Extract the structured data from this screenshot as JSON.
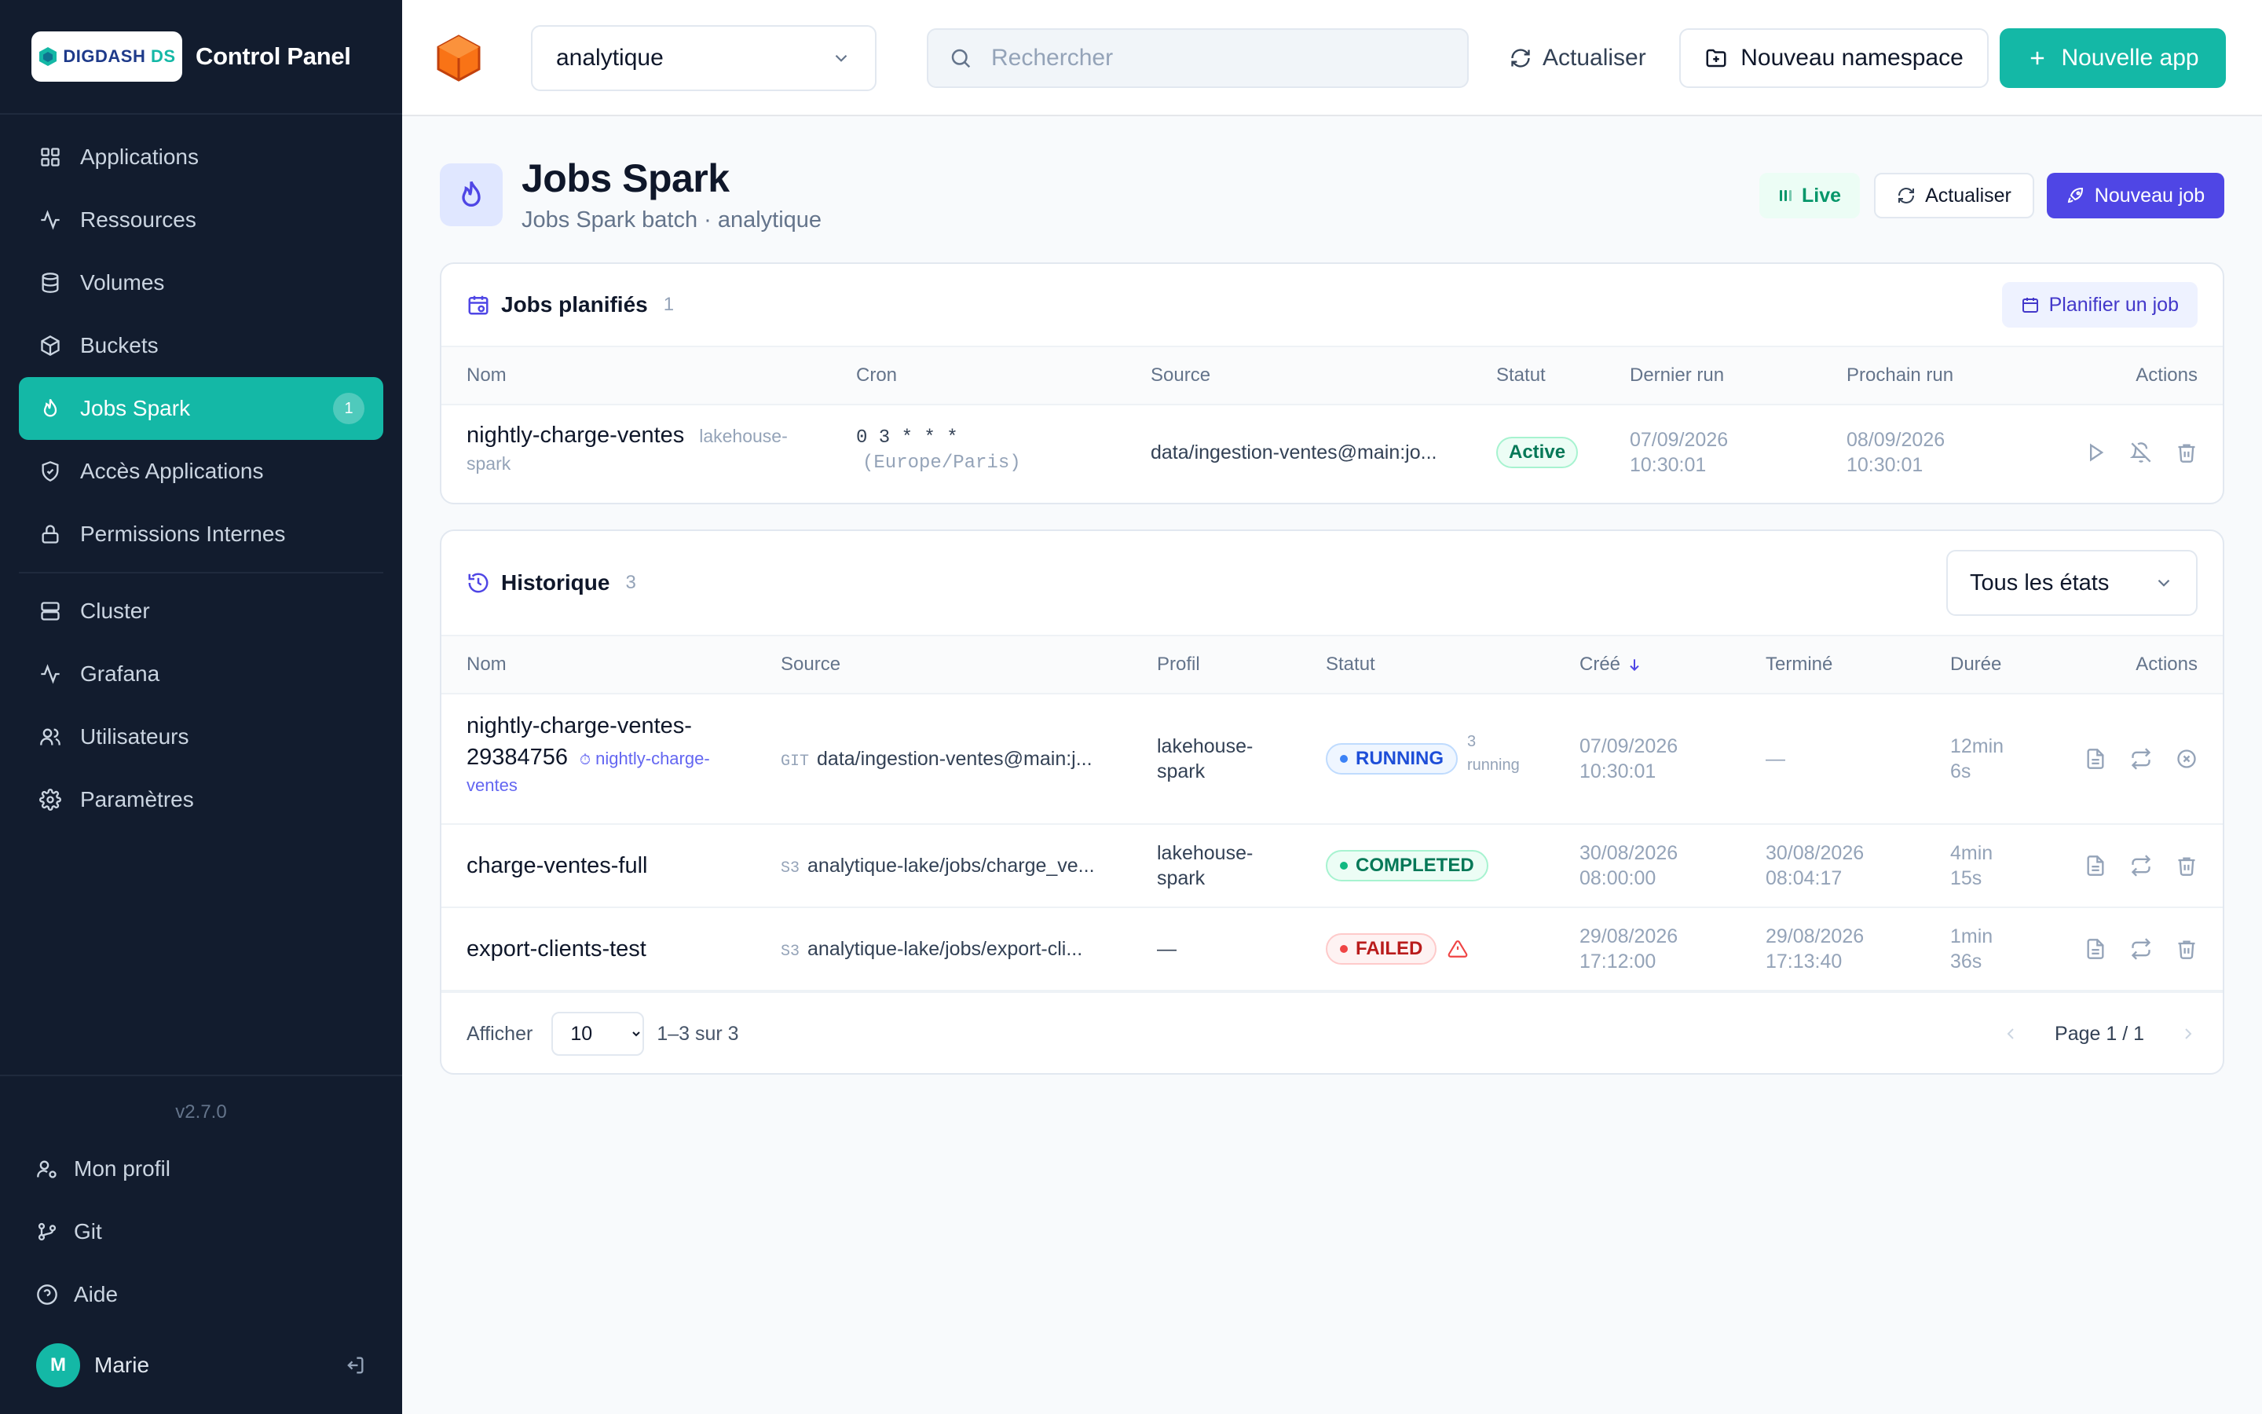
{
  "app": {
    "logo_text": "DIGDASH",
    "logo_suffix": "DS",
    "title": "Control Panel",
    "version": "v2.7.0"
  },
  "sidebar": {
    "items": [
      {
        "label": "Applications",
        "icon": "grid-icon"
      },
      {
        "label": "Ressources",
        "icon": "activity-icon"
      },
      {
        "label": "Volumes",
        "icon": "database-icon"
      },
      {
        "label": "Buckets",
        "icon": "box-icon"
      },
      {
        "label": "Jobs Spark",
        "icon": "flame-icon",
        "active": true,
        "badge": "1"
      },
      {
        "label": "Accès Applications",
        "icon": "shield-icon"
      },
      {
        "label": "Permissions Internes",
        "icon": "lock-icon"
      },
      {
        "label": "Cluster",
        "icon": "server-icon"
      },
      {
        "label": "Grafana",
        "icon": "activity-icon"
      },
      {
        "label": "Utilisateurs",
        "icon": "users-icon"
      },
      {
        "label": "Paramètres",
        "icon": "gear-icon"
      }
    ],
    "bottom": [
      {
        "label": "Mon profil",
        "icon": "user-cog-icon"
      },
      {
        "label": "Git",
        "icon": "git-branch-icon"
      },
      {
        "label": "Aide",
        "icon": "help-icon"
      }
    ],
    "user": {
      "initial": "M",
      "name": "Marie"
    }
  },
  "topbar": {
    "namespace": "analytique",
    "search_placeholder": "Rechercher",
    "refresh_label": "Actualiser",
    "new_namespace_label": "Nouveau namespace",
    "new_app_label": "Nouvelle app"
  },
  "page": {
    "title": "Jobs Spark",
    "subtitle": "Jobs Spark batch · analytique",
    "live_label": "Live",
    "refresh_label": "Actualiser",
    "new_job_label": "Nouveau job"
  },
  "scheduled": {
    "title": "Jobs planifiés",
    "count": "1",
    "plan_button": "Planifier un job",
    "columns": [
      "Nom",
      "Cron",
      "Source",
      "Statut",
      "Dernier run",
      "Prochain run",
      "Actions"
    ],
    "rows": [
      {
        "name": "nightly-charge-ventes",
        "profile_tag_1": "lakehouse-",
        "profile_tag_2": "spark",
        "cron": "0 3 * * *",
        "timezone": "(Europe/Paris)",
        "source": "data/ingestion-ventes@main:jo...",
        "status": "Active",
        "last_run_date": "07/09/2026",
        "last_run_time": "10:30:01",
        "next_run_date": "08/09/2026",
        "next_run_time": "10:30:01"
      }
    ]
  },
  "history": {
    "title": "Historique",
    "count": "3",
    "state_filter": "Tous les états",
    "columns": [
      "Nom",
      "Source",
      "Profil",
      "Statut",
      "Créé",
      "Terminé",
      "Durée",
      "Actions"
    ],
    "rows": [
      {
        "name_1": "nightly-charge-ventes-",
        "name_2": "29384756",
        "schedule_link_1": "nightly-charge-",
        "schedule_link_2": "ventes",
        "source_type": "GIT",
        "source": "data/ingestion-ventes@main:j...",
        "profile_1": "lakehouse-",
        "profile_2": "spark",
        "status": "RUNNING",
        "running_count": "3",
        "running_label": "running",
        "created_date": "07/09/2026",
        "created_time": "10:30:01",
        "ended": "—",
        "duration_1": "12min",
        "duration_2": "6s"
      },
      {
        "name_1": "charge-ventes-full",
        "source_type": "S3",
        "source": "analytique-lake/jobs/charge_ve...",
        "profile_1": "lakehouse-",
        "profile_2": "spark",
        "status": "COMPLETED",
        "created_date": "30/08/2026",
        "created_time": "08:00:00",
        "ended_date": "30/08/2026",
        "ended_time": "08:04:17",
        "duration_1": "4min",
        "duration_2": "15s"
      },
      {
        "name_1": "export-clients-test",
        "source_type": "S3",
        "source": "analytique-lake/jobs/export-cli...",
        "profile_1": "—",
        "status": "FAILED",
        "created_date": "29/08/2026",
        "created_time": "17:12:00",
        "ended_date": "29/08/2026",
        "ended_time": "17:13:40",
        "duration_1": "1min",
        "duration_2": "36s"
      }
    ],
    "footer": {
      "show_label": "Afficher",
      "page_size": "10",
      "range": "1–3 sur 3",
      "page": "Page 1 / 1"
    }
  },
  "colors": {
    "sidebar_bg": "#121c2e",
    "accent_teal": "#14b8a6",
    "accent_indigo": "#4f46e5",
    "status_running": "#1d4ed8",
    "status_completed": "#047857",
    "status_failed": "#b91c1c"
  }
}
